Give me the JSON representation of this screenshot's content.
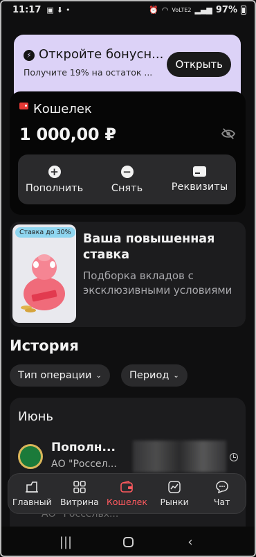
{
  "status_bar": {
    "time": "11:17",
    "network_label": "VoLTE2",
    "battery_percent": "97%"
  },
  "promo": {
    "title": "Откройте бонусн...",
    "subtitle": "Получите 19% на остаток ...",
    "button_label": "Открыть"
  },
  "wallet": {
    "title": "Кошелек",
    "amount": "1 000,00 ₽",
    "actions": [
      {
        "label": "Пополнить",
        "icon": "plus-icon"
      },
      {
        "label": "Снять",
        "icon": "minus-icon"
      },
      {
        "label": "Реквизиты",
        "icon": "card-icon"
      }
    ]
  },
  "deposit_promo": {
    "tag": "Ставка до 30%",
    "title": "Ваша повышенная ставка",
    "subtitle": "Подборка вкладов с эксклюзивными условиями"
  },
  "history": {
    "title": "История",
    "filters": [
      {
        "label": "Тип операции"
      },
      {
        "label": "Период"
      }
    ],
    "month": "Июнь",
    "operations": [
      {
        "title": "Пополн...",
        "subtitle": "АО \"Россел..."
      }
    ],
    "ghost_row_subtitle": "АО \"Россельх..."
  },
  "bottom_nav": {
    "items": [
      {
        "label": "Главный",
        "icon": "home-icon",
        "active": false
      },
      {
        "label": "Витрина",
        "icon": "grid-icon",
        "active": false
      },
      {
        "label": "Кошелек",
        "icon": "wallet-icon",
        "active": true
      },
      {
        "label": "Рынки",
        "icon": "chart-icon",
        "active": false
      },
      {
        "label": "Чат",
        "icon": "chat-icon",
        "active": false
      }
    ]
  },
  "colors": {
    "accent": "#ff5a5f",
    "promo_bg": "#dcd2f7",
    "background": "#0f0f10"
  }
}
